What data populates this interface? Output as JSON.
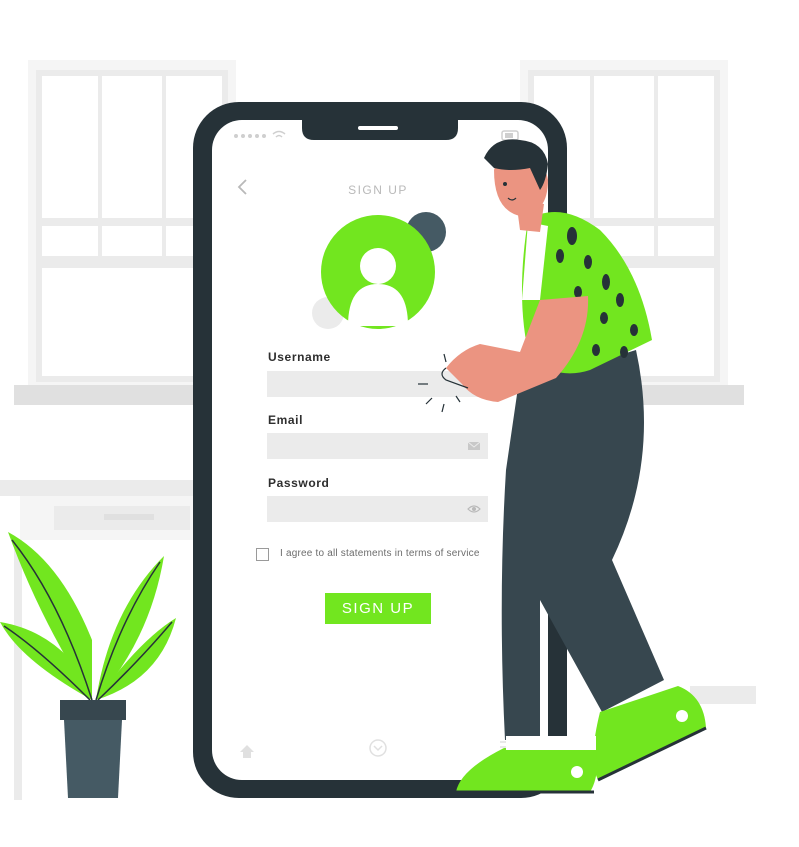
{
  "screen": {
    "title": "SIGN UP",
    "fields": [
      {
        "label": "Username",
        "value": "",
        "icon": "none"
      },
      {
        "label": "Email",
        "value": "",
        "icon": "mail-icon"
      },
      {
        "label": "Password",
        "value": "",
        "icon": "eye-icon"
      }
    ],
    "agree_text": "I agree to all statements in terms of service",
    "agree_checked": false,
    "signup_button": "SIGN UP"
  },
  "colors": {
    "accent": "#72e61f",
    "phone_frame": "#263238",
    "pants": "#37474f",
    "skin": "#eb9481",
    "wall_grey": "#ebebeb"
  },
  "icons": {
    "status_left": "signal-dots-icon",
    "status_wifi": "wifi-icon",
    "status_battery": "battery-icon",
    "back": "chevron-left-icon",
    "avatar": "user-avatar-icon",
    "nav_home": "home-icon",
    "nav_down": "chevron-down-circle-icon",
    "nav_menu": "menu-icon"
  }
}
